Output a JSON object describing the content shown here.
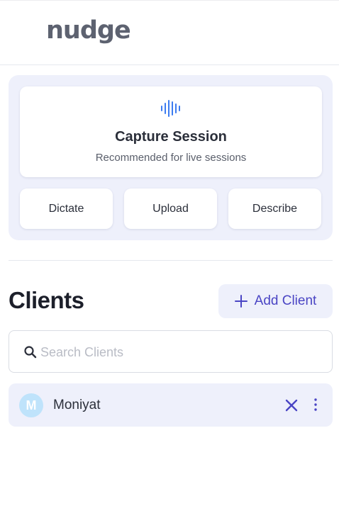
{
  "header": {
    "logo": "nudge"
  },
  "capture": {
    "title": "Capture Session",
    "subtitle": "Recommended for live sessions",
    "icon": "audio-waveform-icon",
    "actions": {
      "dictate": "Dictate",
      "upload": "Upload",
      "describe": "Describe"
    }
  },
  "clients": {
    "title": "Clients",
    "add_label": "Add Client",
    "search_placeholder": "Search Clients",
    "search_value": "",
    "items": [
      {
        "initial": "M",
        "name": "Moniyat"
      }
    ]
  },
  "colors": {
    "accent": "#4a45c4",
    "panel_bg": "#eef0fb",
    "wave": "#3d7cf0",
    "avatar_bg": "#bfe3fb"
  }
}
